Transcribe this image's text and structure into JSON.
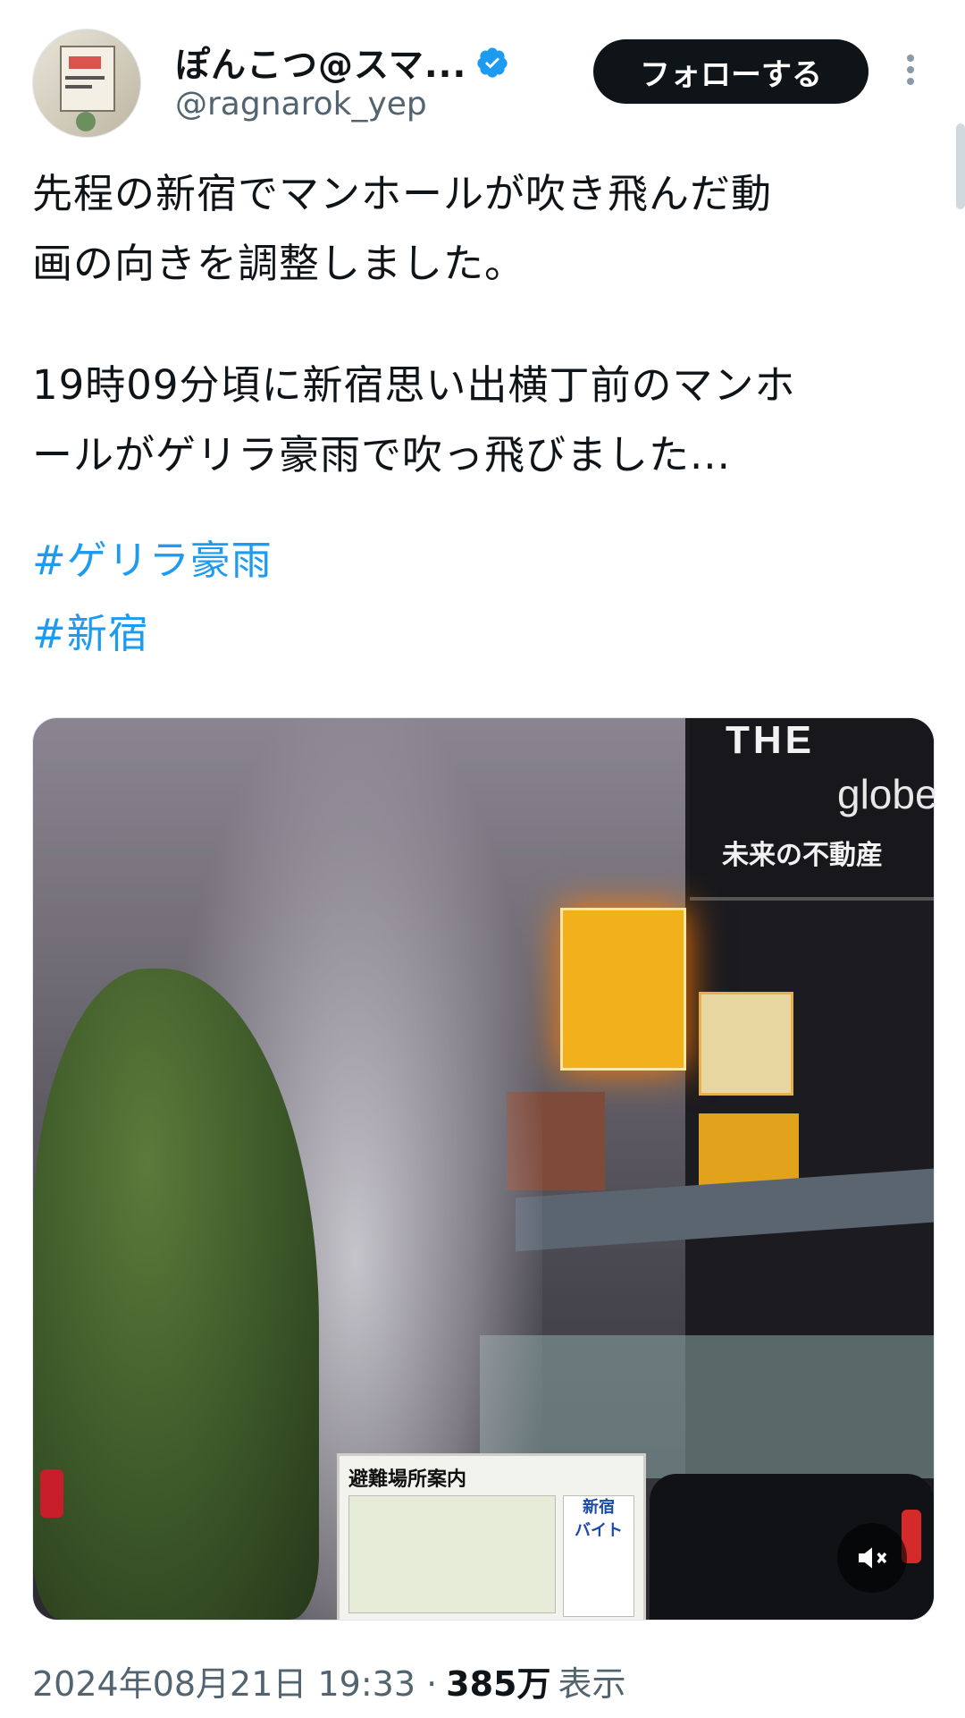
{
  "author": {
    "display_name": "ぽんこつ@スマ...",
    "handle": "@ragnarok_yep",
    "verified": true,
    "avatar_icon": "avatar-image"
  },
  "actions": {
    "follow_label": "フォローする",
    "more_icon": "more-vertical-icon"
  },
  "tweet": {
    "paragraph_1": "先程の新宿でマンホールが吹き飛んだ動\n画の向きを調整しました。",
    "paragraph_2": "19時09分頃に新宿思い出横丁前のマンホ\nールがゲリラ豪雨で吹っ飛びました...",
    "hashtags": [
      "#ゲリラ豪雨",
      "#新宿"
    ]
  },
  "media": {
    "type": "video",
    "scene_text": {
      "billboard_top": "THE",
      "billboard_logo": "globe",
      "billboard_sub": "未来の不動産",
      "sign_title": "避難場所案内",
      "sign_side": "新宿\nバイト"
    },
    "mute_icon": "volume-muted-icon"
  },
  "meta": {
    "datetime": "2024年08月21日 19:33 ·",
    "views_count": "385万",
    "views_label": "表示"
  },
  "colors": {
    "link": "#1d9bf0",
    "secondary_text": "#536471",
    "verified_badge": "#1d9bf0",
    "follow_button_bg": "#0f1419"
  }
}
